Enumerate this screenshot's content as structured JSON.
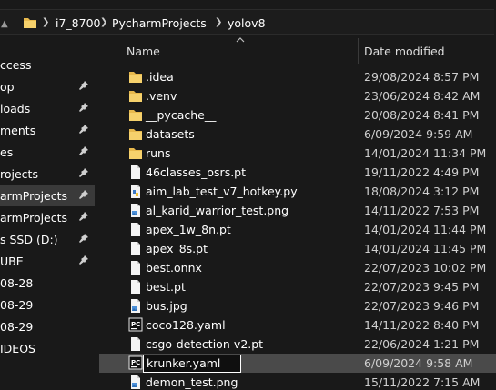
{
  "breadcrumb": [
    "i7_8700",
    "PycharmProjects",
    "yolov8"
  ],
  "nav": {
    "items": [
      {
        "label": "ccess",
        "pinned": false
      },
      {
        "label": "op",
        "pinned": true
      },
      {
        "label": "loads",
        "pinned": true
      },
      {
        "label": "ments",
        "pinned": true
      },
      {
        "label": "es",
        "pinned": true
      },
      {
        "label": "rojects",
        "pinned": true
      },
      {
        "label": "armProjects",
        "pinned": true
      },
      {
        "label": "armProjects",
        "pinned": true
      },
      {
        "label": "s SSD (D:)",
        "pinned": true
      },
      {
        "label": "UBE",
        "pinned": true
      },
      {
        "label": "08-28",
        "pinned": false
      },
      {
        "label": "08-29",
        "pinned": false
      },
      {
        "label": "08-29",
        "pinned": false
      },
      {
        "label": "IDEOS",
        "pinned": false
      }
    ]
  },
  "columns": {
    "name": "Name",
    "date": "Date modified"
  },
  "files": [
    {
      "name": ".idea",
      "date": "29/08/2024 8:57 PM",
      "icon": "folder-icon"
    },
    {
      "name": ".venv",
      "date": "23/06/2024 8:42 AM",
      "icon": "folder-icon"
    },
    {
      "name": "__pycache__",
      "date": "20/08/2024 8:41 PM",
      "icon": "folder-icon"
    },
    {
      "name": "datasets",
      "date": "6/09/2024 9:59 AM",
      "icon": "folder-icon"
    },
    {
      "name": "runs",
      "date": "14/01/2024 11:34 PM",
      "icon": "folder-icon"
    },
    {
      "name": "46classes_osrs.pt",
      "date": "19/11/2022 4:49 PM",
      "icon": "file-icon"
    },
    {
      "name": "aim_lab_test_v7_hotkey.py",
      "date": "18/08/2024 3:12 PM",
      "icon": "python-file-icon"
    },
    {
      "name": "al_karid_warrior_test.png",
      "date": "14/11/2022 7:53 PM",
      "icon": "image-file-icon"
    },
    {
      "name": "apex_1w_8n.pt",
      "date": "14/01/2024 11:44 PM",
      "icon": "file-icon"
    },
    {
      "name": "apex_8s.pt",
      "date": "14/01/2024 11:45 PM",
      "icon": "file-icon"
    },
    {
      "name": "best.onnx",
      "date": "22/07/2023 10:02 PM",
      "icon": "file-icon"
    },
    {
      "name": "best.pt",
      "date": "22/07/2023 9:45 PM",
      "icon": "file-icon"
    },
    {
      "name": "bus.jpg",
      "date": "22/07/2023 9:46 PM",
      "icon": "image-file-icon"
    },
    {
      "name": "coco128.yaml",
      "date": "14/11/2022 8:40 PM",
      "icon": "pycharm-file-icon"
    },
    {
      "name": "csgo-detection-v2.pt",
      "date": "22/06/2024 1:21 PM",
      "icon": "file-icon"
    },
    {
      "name": "krunker.yaml",
      "date": "6/09/2024 9:58 AM",
      "icon": "pycharm-file-icon",
      "selected": true
    },
    {
      "name": "demon_test.png",
      "date": "15/11/2022 7:15 AM",
      "icon": "image-file-icon"
    }
  ]
}
